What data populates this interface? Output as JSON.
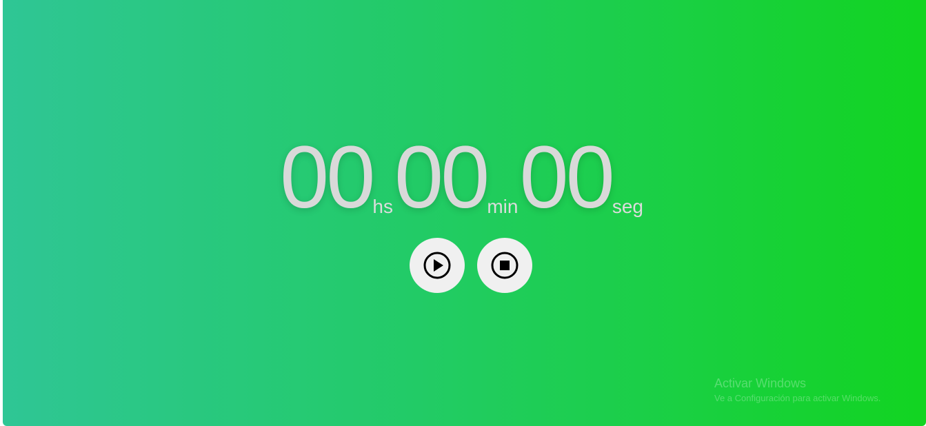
{
  "timer": {
    "hours": "00",
    "hours_unit": "hs",
    "minutes": "00",
    "minutes_unit": "min",
    "seconds": "00",
    "seconds_unit": "seg"
  },
  "controls": {
    "play_icon": "play-circle-icon",
    "stop_icon": "stop-circle-icon"
  },
  "watermark": {
    "title": "Activar Windows",
    "subtitle": "Ve a Configuración para activar Windows."
  },
  "colors": {
    "gradient_start": "#2fc695",
    "gradient_end": "#12d421",
    "digits": "#d9d9d9",
    "button_bg": "#f0f0f0"
  }
}
